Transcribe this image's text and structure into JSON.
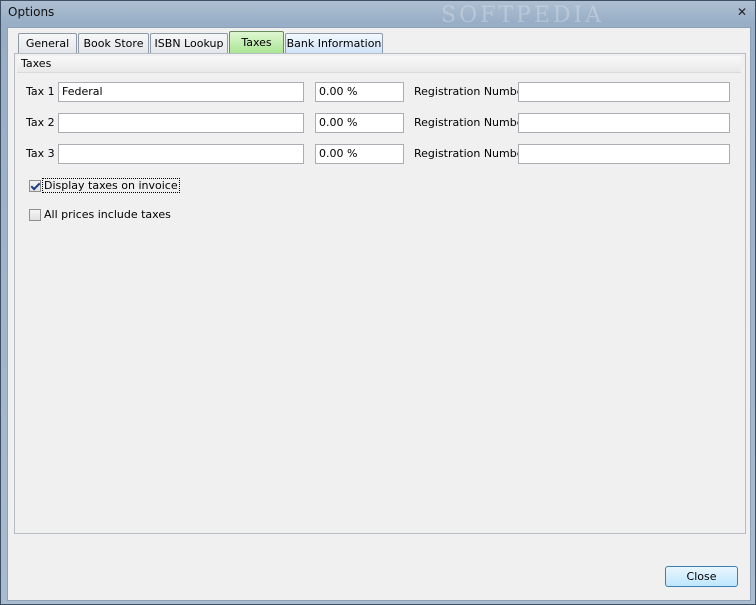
{
  "window": {
    "title": "Options",
    "watermark": "SOFTPEDIA",
    "close_glyph": "✕"
  },
  "tabs": [
    {
      "label": "General"
    },
    {
      "label": "Book Store"
    },
    {
      "label": "ISBN Lookup"
    },
    {
      "label": "Taxes",
      "active": true
    },
    {
      "label": "Bank Information"
    }
  ],
  "taxes": {
    "group_title": "Taxes",
    "rows": [
      {
        "label": "Tax 1",
        "name_value": "Federal",
        "rate_value": "0.00 %",
        "reg_label": "Registration Number",
        "reg_value": ""
      },
      {
        "label": "Tax 2",
        "name_value": "",
        "rate_value": "0.00 %",
        "reg_label": "Registration Number",
        "reg_value": ""
      },
      {
        "label": "Tax 3",
        "name_value": "",
        "rate_value": "0.00 %",
        "reg_label": "Registration Number",
        "reg_value": ""
      }
    ],
    "display_taxes": {
      "label": "Display taxes on invoice",
      "checked": true
    },
    "prices_include": {
      "label": "All prices include taxes",
      "checked": false
    }
  },
  "footer": {
    "close_label": "Close"
  },
  "colors": {
    "active_tab": "#a8e592",
    "close_button_border": "#3c7fb1"
  }
}
